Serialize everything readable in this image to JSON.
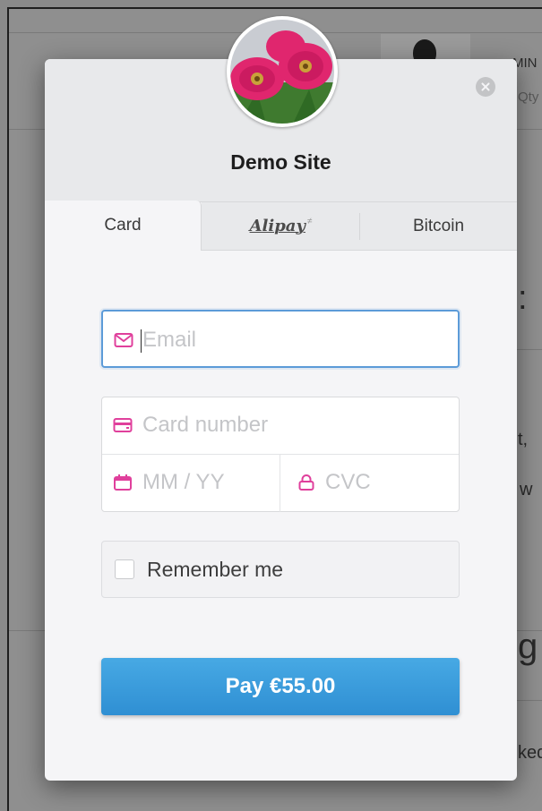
{
  "background_page": {
    "text_fragments": [
      "MIN",
      "Qty",
      ":",
      "t,",
      "w",
      "g",
      "ked"
    ]
  },
  "modal": {
    "site_title": "Demo Site",
    "close_icon": "close-icon",
    "avatar_image": "pink gerbera daisies"
  },
  "tabs": [
    {
      "label": "Card",
      "active": true
    },
    {
      "label": "Alipay",
      "logo_suffix": "≠",
      "active": false
    },
    {
      "label": "Bitcoin",
      "active": false
    }
  ],
  "form": {
    "email": {
      "placeholder": "Email",
      "icon": "envelope-icon",
      "focused": true
    },
    "card_number": {
      "placeholder": "Card number",
      "icon": "credit-card-icon"
    },
    "expiry": {
      "placeholder": "MM / YY",
      "icon": "calendar-icon"
    },
    "cvc": {
      "placeholder": "CVC",
      "icon": "lock-icon"
    },
    "remember": {
      "label": "Remember me",
      "checked": false
    },
    "pay_button": {
      "label": "Pay €55.00"
    }
  },
  "colors": {
    "accent_blue": "#3a9ad9",
    "icon_pink": "#e0409c",
    "focus_border": "#5c9bd8"
  }
}
